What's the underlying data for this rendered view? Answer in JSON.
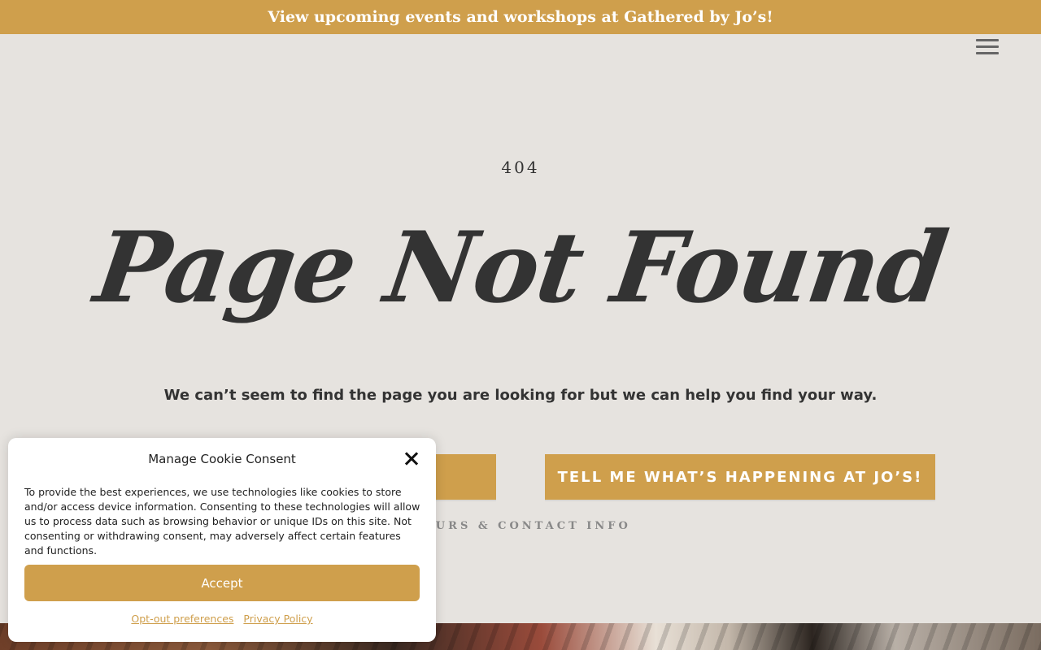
{
  "banner": {
    "text": "View upcoming events and workshops at Gathered by Jo’s!"
  },
  "header": {
    "menu_icon": "hamburger-menu-icon"
  },
  "main": {
    "code": "404",
    "headline": "Page Not Found",
    "subline": "We can’t seem to find the page you are looking for but we can help you find your way.",
    "button_left_label": "",
    "button_right_label": "TELL ME WHAT’S HAPPENING AT JO’S!",
    "hours_link": "HOURS & CONTACT INFO"
  },
  "cookie_consent": {
    "title": "Manage Cookie Consent",
    "close_icon": "close-icon",
    "body": "To provide the best experiences, we use technologies like cookies to store and/or access device information. Consenting to these technologies will allow us to process data such as browsing behavior or unique IDs on this site. Not consenting or withdrawing consent, may adversely affect certain features and functions.",
    "accept_label": "Accept",
    "optout_label": "Opt-out preferences",
    "privacy_label": "Privacy Policy"
  },
  "colors": {
    "accent": "#cf9f4c",
    "background": "#e6e3df",
    "text": "#333333"
  }
}
